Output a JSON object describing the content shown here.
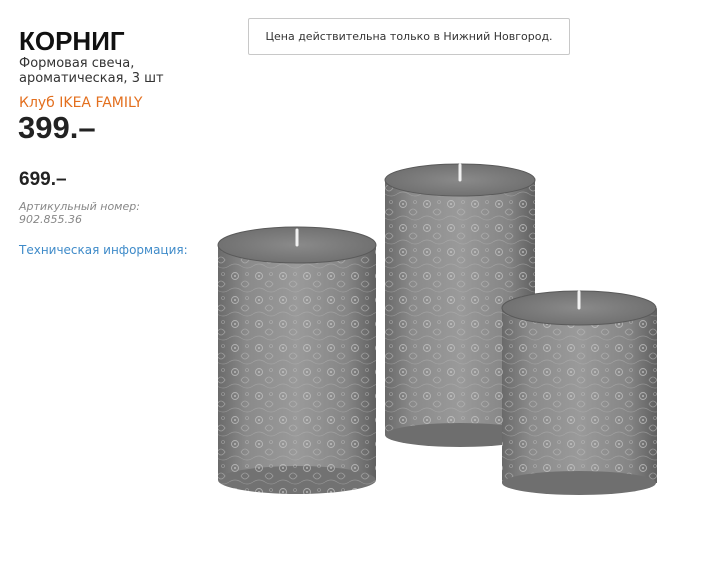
{
  "product": {
    "name": "КОРНИГ",
    "description": "Формовая свеча, ароматическая, 3 шт",
    "family_label": "Клуб IKEA FAMILY",
    "family_price": "399.–",
    "regular_price": "699.–",
    "article": "Артикульный номер: 902.855.36",
    "tech_info_link": "Техническая информация:"
  },
  "notice": {
    "text": "Цена действительна только в Нижний Новгород."
  },
  "colors": {
    "family_accent": "#e36f1e",
    "link": "#3f8bc9",
    "candle": "#808080"
  },
  "image": {
    "subject": "three grey lace-patterned pillar candles"
  }
}
